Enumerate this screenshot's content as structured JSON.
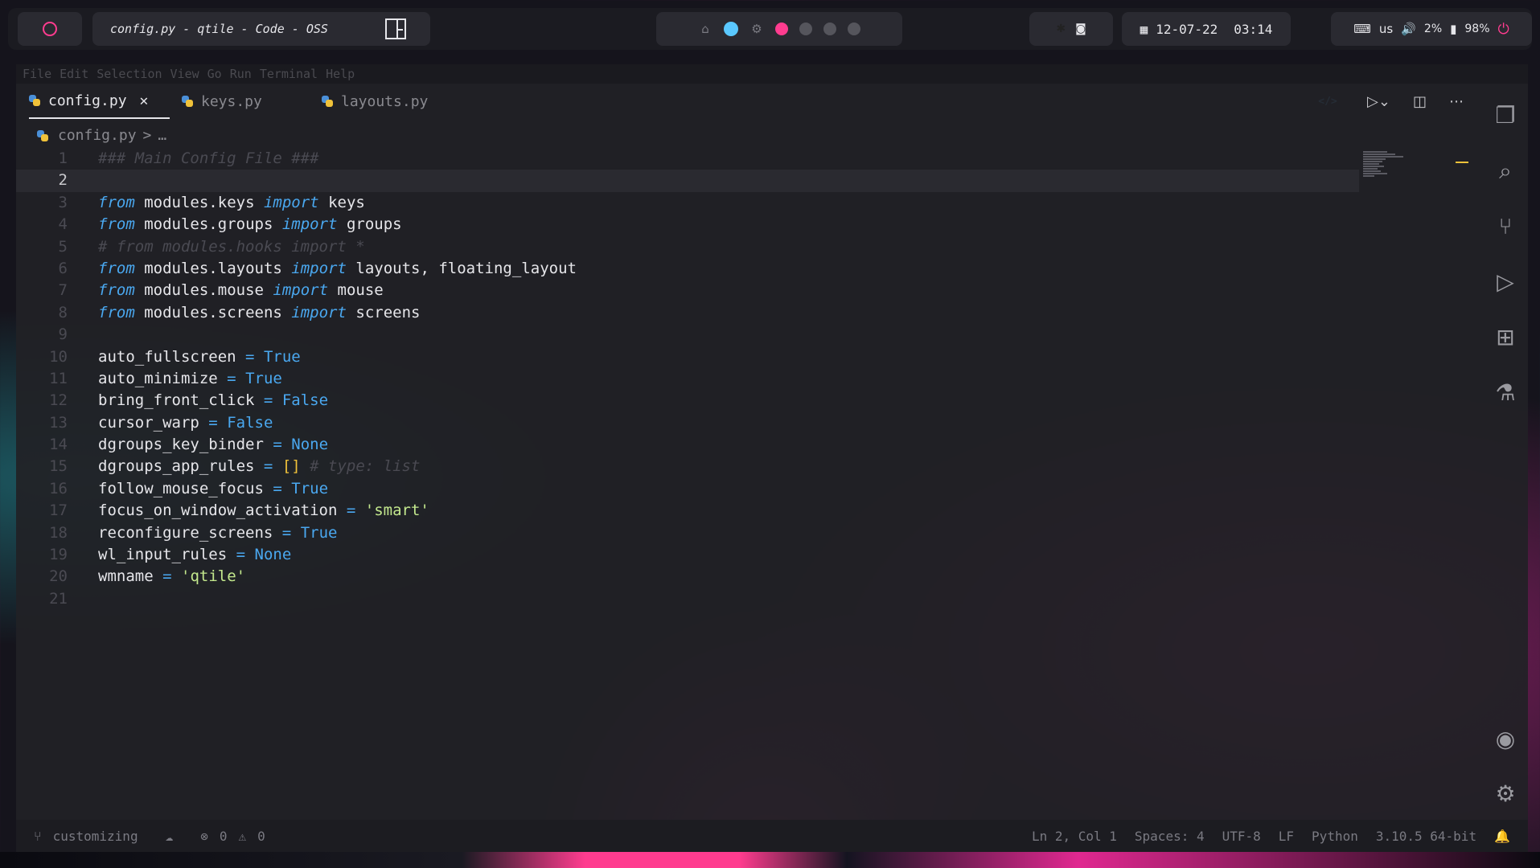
{
  "topbar": {
    "window_title": "config.py - qtile - Code - OSS",
    "tray_icons": [
      "bluetooth-icon",
      "discord-icon"
    ],
    "date": "12-07-22",
    "time": "03:14",
    "keyboard_layout": "us",
    "volume": "2%",
    "battery": "98%"
  },
  "menu": [
    "File",
    "Edit",
    "Selection",
    "View",
    "Go",
    "Run",
    "Terminal",
    "Help"
  ],
  "tabs": [
    {
      "label": "config.py",
      "active": true
    },
    {
      "label": "keys.py",
      "active": false
    },
    {
      "label": "layouts.py",
      "active": false
    }
  ],
  "breadcrumb": {
    "file": "config.py",
    "separator": ">",
    "more": "…"
  },
  "code_lines": [
    "### Main Config File ###",
    "",
    "from modules.keys import keys",
    "from modules.groups import groups",
    "# from modules.hooks import *",
    "from modules.layouts import layouts, floating_layout",
    "from modules.mouse import mouse",
    "from modules.screens import screens",
    "",
    "auto_fullscreen = True",
    "auto_minimize = True",
    "bring_front_click = False",
    "cursor_warp = False",
    "dgroups_key_binder = None",
    "dgroups_app_rules = [] # type: list",
    "follow_mouse_focus = True",
    "focus_on_window_activation = 'smart'",
    "reconfigure_screens = True",
    "wl_input_rules = None",
    "wmname = 'qtile'",
    ""
  ],
  "line_numbers": [
    "1",
    "2",
    "3",
    "4",
    "5",
    "6",
    "7",
    "8",
    "9",
    "10",
    "11",
    "12",
    "13",
    "14",
    "15",
    "16",
    "17",
    "18",
    "19",
    "20",
    "21"
  ],
  "current_line": 2,
  "statusbar": {
    "branch": "customizing",
    "errors": "0",
    "warnings": "0",
    "cursor": "Ln 2, Col 1",
    "spaces": "Spaces: 4",
    "encoding": "UTF-8",
    "eol": "LF",
    "language": "Python",
    "interpreter": "3.10.5 64-bit"
  },
  "colors": {
    "accent_pink": "#ff3c8f",
    "keyword_blue": "#4aa8f0",
    "string_green": "#c3e88d"
  }
}
